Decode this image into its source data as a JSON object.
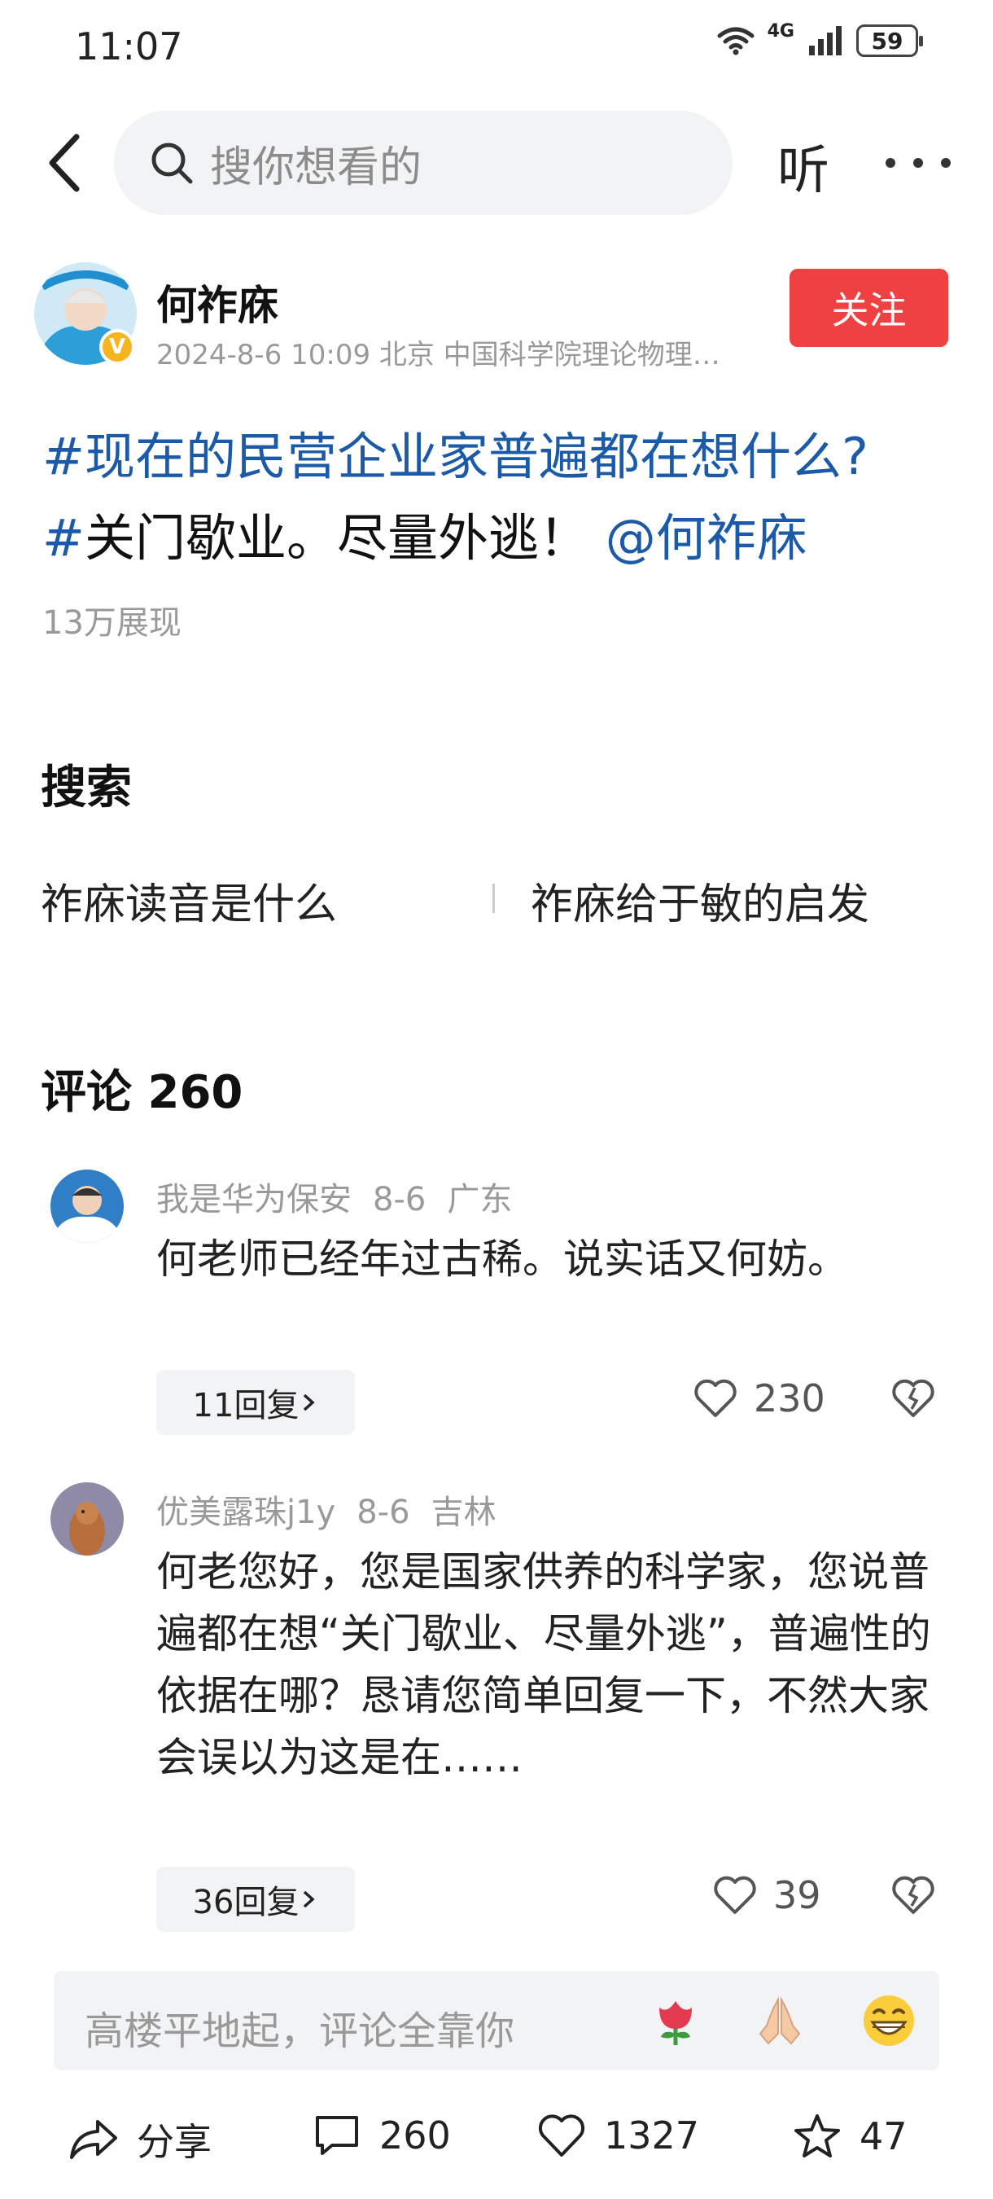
{
  "status_bar": {
    "time": "11:07",
    "network": "4G",
    "battery": "59"
  },
  "header": {
    "search_placeholder": "搜你想看的",
    "listen_label": "听"
  },
  "author": {
    "name": "何祚庥",
    "meta": "2024-8-6 10:09 北京 中国科学院理论物理…",
    "follow_label": "关注",
    "verified_badge": "V"
  },
  "post": {
    "hash1": "#",
    "topic": "现在的民营企业家普遍都在想什么?",
    "hash2": "#",
    "text": "关门歇业。尽量外逃！",
    "mention": "@何祚庥",
    "views": "13万展现"
  },
  "search_section": {
    "title": "搜索",
    "suggestions": [
      "祚庥读音是什么",
      "祚庥给于敏的启发"
    ]
  },
  "comments_section": {
    "title": "评论 260",
    "comments": [
      {
        "user": "我是华为保安",
        "date": "8-6",
        "location": "广东",
        "text": "何老师已经年过古稀。说实话又何妨。",
        "replies": "11回复",
        "likes": "230"
      },
      {
        "user": "优美露珠j1y",
        "date": "8-6",
        "location": "吉林",
        "text": "何老您好，您是国家供养的科学家，您说普遍都在想“关门歇业、尽量外逃”，普遍性的依据在哪？恳请您简单回复一下，不然大家会误以为这是在……",
        "replies": "36回复",
        "likes": "39"
      }
    ]
  },
  "comment_input": {
    "placeholder": "高楼平地起，评论全靠你"
  },
  "action_bar": {
    "share_label": "分享",
    "comments_count": "260",
    "likes_count": "1327",
    "favorites_count": "47"
  },
  "colors": {
    "link_blue": "#1b5aa8",
    "follow_red": "#f04142",
    "muted_gray": "#999999"
  }
}
